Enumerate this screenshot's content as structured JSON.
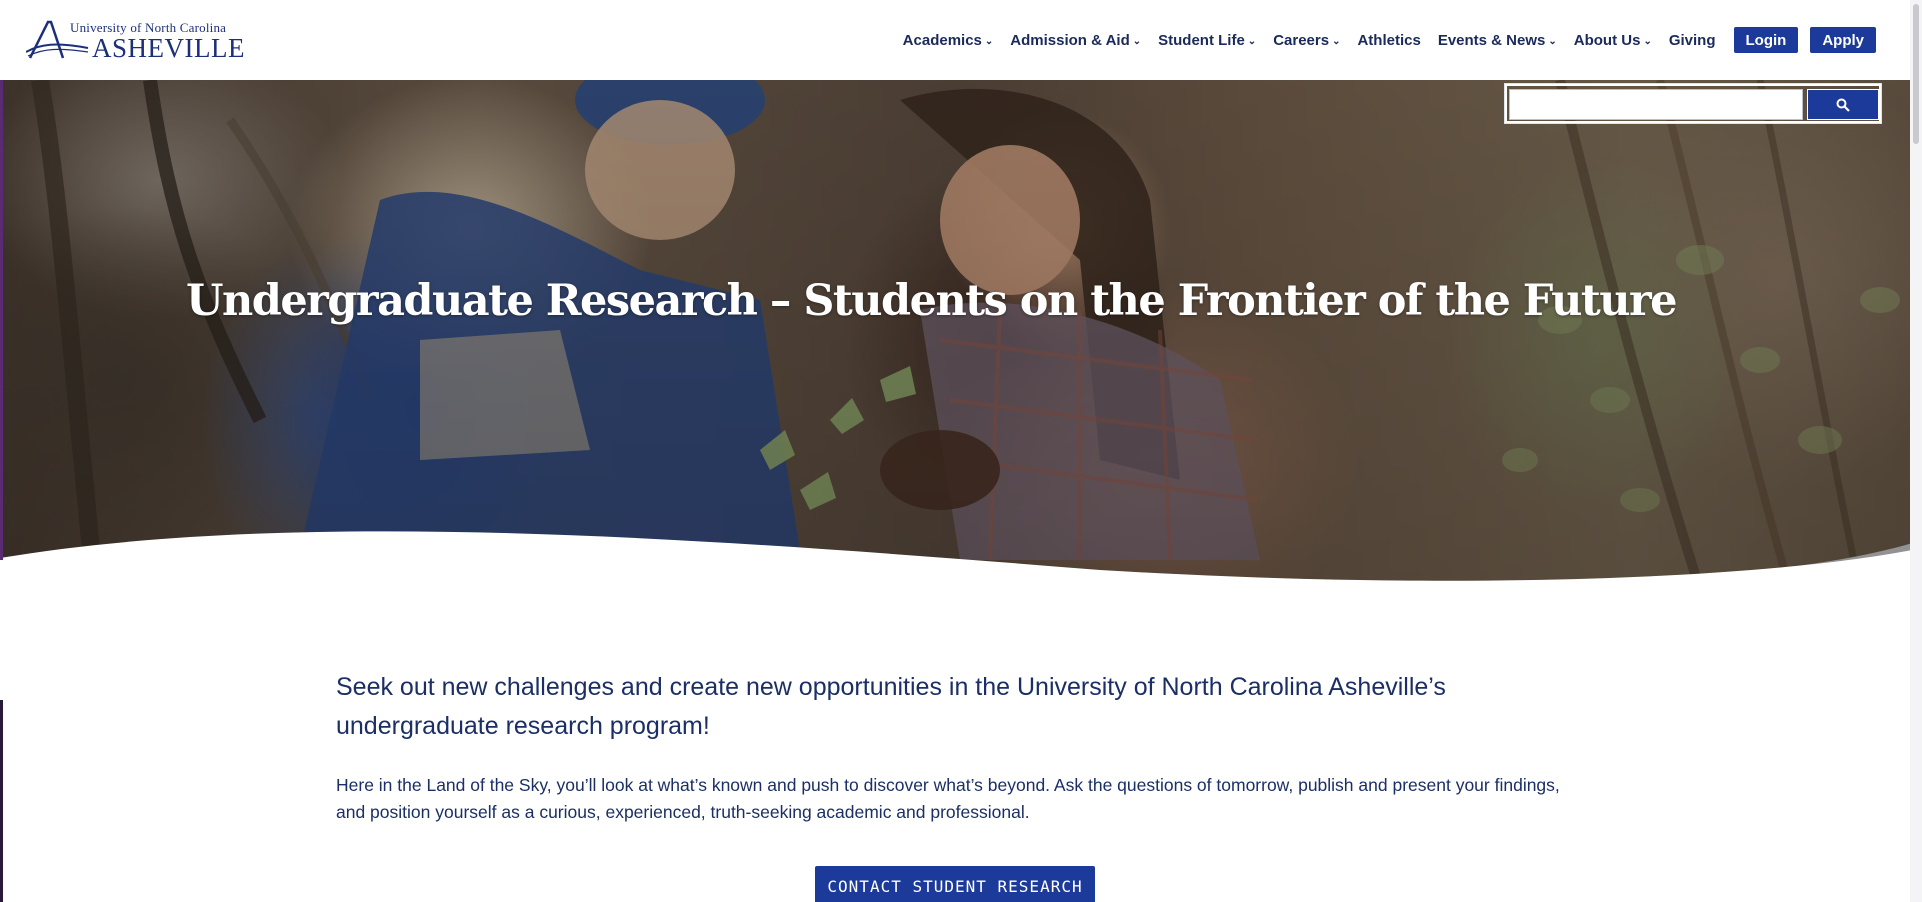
{
  "logo": {
    "line1": "University of North Carolina",
    "line2": "ASHEVILLE"
  },
  "nav": {
    "items": [
      {
        "label": "Academics",
        "has_dropdown": true
      },
      {
        "label": "Admission & Aid",
        "has_dropdown": true
      },
      {
        "label": "Student Life",
        "has_dropdown": true
      },
      {
        "label": "Careers",
        "has_dropdown": true
      },
      {
        "label": "Athletics",
        "has_dropdown": false
      },
      {
        "label": "Events & News",
        "has_dropdown": true
      },
      {
        "label": "About Us",
        "has_dropdown": true
      },
      {
        "label": "Giving",
        "has_dropdown": false
      }
    ],
    "login_label": "Login",
    "apply_label": "Apply",
    "chevron_glyph": "⌄"
  },
  "search": {
    "value": "",
    "placeholder": "",
    "button_icon": "search-icon"
  },
  "hero": {
    "title": "Undergraduate Research – Students on the Frontier of the Future"
  },
  "main": {
    "lead": "Seek out new challenges and create new opportunities in the University of North Carolina Asheville’s undergraduate research program!",
    "body": "Here in the Land of the Sky, you’ll look at what’s known and push to discover what’s beyond. Ask the questions of tomorrow, publish and present your findings, and position yourself as a curious, experienced, truth-seeking academic and professional.",
    "cta_label": "CONTACT STUDENT RESEARCH"
  },
  "colors": {
    "brand_blue": "#1c3a9a",
    "text_navy": "#1b2f66",
    "nav_text": "#1b2a5c"
  }
}
